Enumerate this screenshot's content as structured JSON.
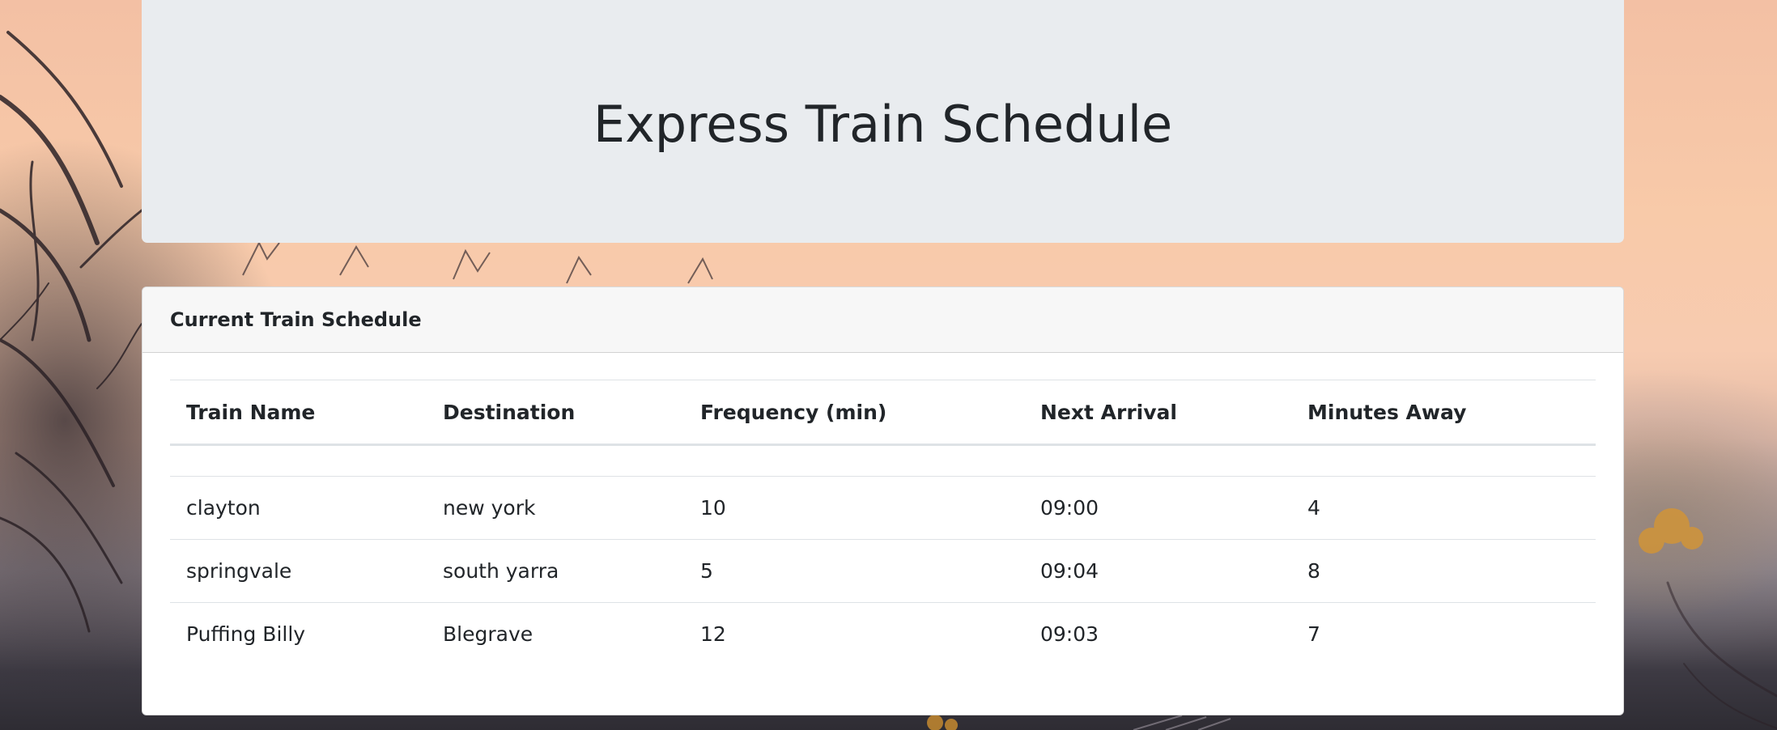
{
  "page": {
    "title": "Express Train Schedule"
  },
  "schedule_card": {
    "header": "Current Train Schedule",
    "columns": [
      "Train Name",
      "Destination",
      "Frequency (min)",
      "Next Arrival",
      "Minutes Away"
    ],
    "rows": [
      [
        "clayton",
        "new york",
        "10",
        "09:00",
        "4"
      ],
      [
        "springvale",
        "south yarra",
        "5",
        "09:04",
        "8"
      ],
      [
        "Puffing Billy",
        "Blegrave",
        "12",
        "09:03",
        "7"
      ]
    ]
  },
  "colors": {
    "jumbotron_bg": "#e9ecef",
    "card_header_bg": "#f7f7f7",
    "text": "#212529",
    "border": "#dee2e6"
  }
}
